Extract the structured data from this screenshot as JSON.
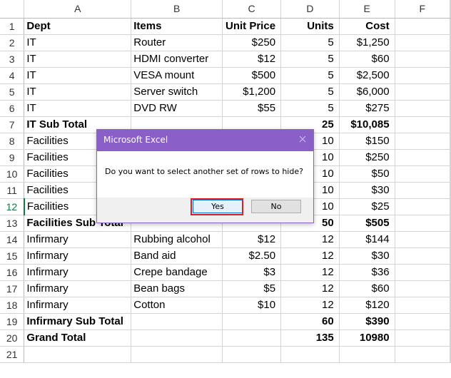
{
  "columns": [
    "A",
    "B",
    "C",
    "D",
    "E",
    "F"
  ],
  "rows": [
    {
      "num": "1",
      "a": "Dept",
      "b": "Items",
      "c": "Unit Price",
      "d": "Units",
      "e": "Cost",
      "header": true
    },
    {
      "num": "2",
      "a": "IT",
      "b": "Router",
      "c": "$250",
      "d": "5",
      "e": "$1,250"
    },
    {
      "num": "3",
      "a": "IT",
      "b": "HDMI converter",
      "c": "$12",
      "d": "5",
      "e": "$60"
    },
    {
      "num": "4",
      "a": "IT",
      "b": "VESA mount",
      "c": "$500",
      "d": "5",
      "e": "$2,500"
    },
    {
      "num": "5",
      "a": "IT",
      "b": "Server switch",
      "c": "$1,200",
      "d": "5",
      "e": "$6,000"
    },
    {
      "num": "6",
      "a": "IT",
      "b": "DVD RW",
      "c": "$55",
      "d": "5",
      "e": "$275"
    },
    {
      "num": "7",
      "a": "IT Sub Total",
      "b": "",
      "c": "",
      "d": "25",
      "e": "$10,085",
      "bold": true
    },
    {
      "num": "8",
      "a": "Facilities",
      "b": "",
      "c": "",
      "d": "10",
      "e": "$150"
    },
    {
      "num": "9",
      "a": "Facilities",
      "b": "",
      "c": "",
      "d": "10",
      "e": "$250"
    },
    {
      "num": "10",
      "a": "Facilities",
      "b": "",
      "c": "",
      "d": "10",
      "e": "$50"
    },
    {
      "num": "11",
      "a": "Facilities",
      "b": "",
      "c": "",
      "d": "10",
      "e": "$30"
    },
    {
      "num": "12",
      "a": "Facilities",
      "b": "",
      "c": "",
      "d": "10",
      "e": "$25"
    },
    {
      "num": "13",
      "a": "Facilities Sub Total",
      "b": "",
      "c": "",
      "d": "50",
      "e": "$505",
      "bold": true
    },
    {
      "num": "14",
      "a": "Infirmary",
      "b": "Rubbing alcohol",
      "c": "$12",
      "d": "12",
      "e": "$144"
    },
    {
      "num": "15",
      "a": "Infirmary",
      "b": "Band aid",
      "c": "$2.50",
      "d": "12",
      "e": "$30"
    },
    {
      "num": "16",
      "a": "Infirmary",
      "b": "Crepe bandage",
      "c": "$3",
      "d": "12",
      "e": "$36"
    },
    {
      "num": "17",
      "a": "Infirmary",
      "b": "Bean bags",
      "c": "$5",
      "d": "12",
      "e": "$60"
    },
    {
      "num": "18",
      "a": "Infirmary",
      "b": "Cotton",
      "c": "$10",
      "d": "12",
      "e": "$120"
    },
    {
      "num": "19",
      "a": "Infirmary Sub Total",
      "b": "",
      "c": "",
      "d": "60",
      "e": "$390",
      "bold": true
    },
    {
      "num": "20",
      "a": "Grand Total",
      "b": "",
      "c": "",
      "d": "135",
      "e": "10980",
      "bold": true
    },
    {
      "num": "21",
      "a": "",
      "b": "",
      "c": "",
      "d": "",
      "e": ""
    }
  ],
  "active_row": "12",
  "dialog": {
    "title": "Microsoft Excel",
    "message": "Do you want to select another set of rows to hide?",
    "yes_label": "Yes",
    "no_label": "No",
    "close_icon": "close-icon"
  },
  "colors": {
    "dialog_titlebar": "#8a5fc8",
    "highlight": "#e11b22",
    "active_row_header": "#107c41"
  }
}
